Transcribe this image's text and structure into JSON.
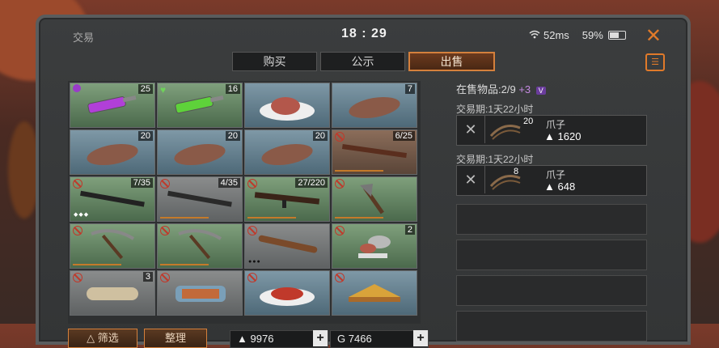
{
  "header": {
    "title": "交易",
    "clock": "18 : 29",
    "ping": "52ms",
    "battery": "59%"
  },
  "tabs": [
    {
      "label": "购买",
      "active": false
    },
    {
      "label": "公示",
      "active": false
    },
    {
      "label": "出售",
      "active": true
    }
  ],
  "inventory": [
    {
      "item": "purple-syringe",
      "count": "25",
      "badge": "purple-skull"
    },
    {
      "item": "green-syringe",
      "count": "16",
      "badge": "green-heart"
    },
    {
      "item": "ham-dish",
      "count": "",
      "badge": ""
    },
    {
      "item": "raw-meat",
      "count": "7",
      "badge": ""
    },
    {
      "item": "raw-meat",
      "count": "20",
      "badge": ""
    },
    {
      "item": "raw-meat",
      "count": "20",
      "badge": ""
    },
    {
      "item": "raw-meat",
      "count": "20",
      "badge": ""
    },
    {
      "item": "shotgun",
      "count": "6/25",
      "badge": "no-sell"
    },
    {
      "item": "rifle",
      "count": "7/35",
      "badge": "no-sell"
    },
    {
      "item": "shotgun",
      "count": "4/35",
      "badge": "no-sell"
    },
    {
      "item": "smg",
      "count": "27/220",
      "badge": "no-sell"
    },
    {
      "item": "axe",
      "count": "",
      "badge": "no-sell"
    },
    {
      "item": "pickaxe",
      "count": "",
      "badge": "no-sell"
    },
    {
      "item": "pickaxe",
      "count": "",
      "badge": "no-sell"
    },
    {
      "item": "spiked-bat",
      "count": "",
      "badge": "no-sell"
    },
    {
      "item": "canned-food",
      "count": "2",
      "badge": "no-sell"
    },
    {
      "item": "cloth-roll",
      "count": "3",
      "badge": "no-sell"
    },
    {
      "item": "sardine-tin",
      "count": "",
      "badge": "no-sell"
    },
    {
      "item": "salad-dish",
      "count": "",
      "badge": "no-sell"
    },
    {
      "item": "sandwich",
      "count": "",
      "badge": "no-sell"
    }
  ],
  "sale_panel": {
    "on_sale_label": "在售物品:2/9",
    "on_sale_plus": "+3",
    "listings": [
      {
        "period": "交易期:1天22小时",
        "qty": "20",
        "name": "爪子",
        "price": "1620"
      },
      {
        "period": "交易期:1天22小时",
        "qty": "8",
        "name": "爪子",
        "price": "648"
      }
    ]
  },
  "footer": {
    "filter_label": "筛选",
    "sort_label": "整理",
    "currency1": "9976",
    "currency2": "7466"
  },
  "colors": {
    "accent": "#d4803c",
    "nosell": "#c0392b"
  }
}
